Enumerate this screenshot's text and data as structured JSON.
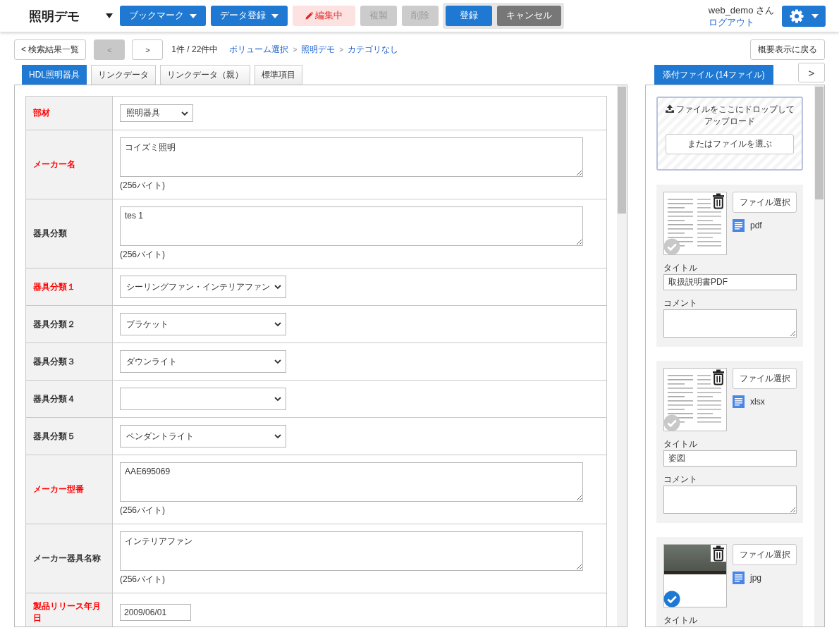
{
  "header": {
    "app_title": "照明デモ",
    "toolbar": [
      {
        "label": "ブックマーク",
        "kind": "menu",
        "disabled": false
      },
      {
        "label": "データ登録",
        "kind": "menu",
        "disabled": false
      },
      {
        "label": "編集中",
        "kind": "status",
        "disabled": false
      },
      {
        "label": "複製",
        "kind": "action",
        "disabled": true
      },
      {
        "label": "削除",
        "kind": "action",
        "disabled": true
      }
    ],
    "save_group": [
      {
        "label": "登録",
        "kind": "primary"
      },
      {
        "label": "キャンセル",
        "kind": "secondary"
      }
    ],
    "user": {
      "name": "web_demo さん",
      "logout_link": "ログアウト"
    }
  },
  "nav": {
    "back_button": "< 検索結果一覧",
    "prev_button": {
      "label": "<",
      "disabled": true
    },
    "next_button": {
      "label": ">",
      "disabled": false
    },
    "record_count": "1件 / 22件中",
    "breadcrumb": [
      {
        "kind": "link",
        "text": "ボリューム選択"
      },
      {
        "kind": "separator",
        "text": ">"
      },
      {
        "kind": "link",
        "text": "照明デモ"
      },
      {
        "kind": "separator",
        "text": ">"
      },
      {
        "kind": "link",
        "text": "カテゴリなし"
      }
    ],
    "overview_button": "概要表示に戻る"
  },
  "tabs": [
    {
      "label": "HDL照明器具",
      "selected": true
    },
    {
      "label": "リンクデータ",
      "selected": false
    },
    {
      "label": "リンクデータ（親）",
      "selected": false
    },
    {
      "label": "標準項目",
      "selected": false
    }
  ],
  "form": [
    {
      "label": "部材",
      "required": true,
      "kind": "select",
      "value": "照明器具"
    },
    {
      "label": "メーカー名",
      "required": true,
      "kind": "textarea",
      "value": "コイズミ照明",
      "note": "(256バイト)"
    },
    {
      "label": "器具分類",
      "required": false,
      "kind": "textarea",
      "value": "tes 1",
      "note": "(256バイト)"
    },
    {
      "label": "器具分類１",
      "required": true,
      "kind": "select",
      "value": "シーリングファン・インテリアファン"
    },
    {
      "label": "器具分類２",
      "required": false,
      "kind": "select",
      "value": "ブラケット"
    },
    {
      "label": "器具分類３",
      "required": false,
      "kind": "select",
      "value": "ダウンライト"
    },
    {
      "label": "器具分類４",
      "required": false,
      "kind": "select"
    },
    {
      "label": "器具分類５",
      "required": false,
      "kind": "select",
      "value": "ペンダントライト"
    },
    {
      "label": "メーカー型番",
      "required": true,
      "kind": "textarea",
      "value": "AAE695069",
      "note": "(256バイト)"
    },
    {
      "label": "メーカー器具名称",
      "required": false,
      "kind": "textarea",
      "value": "インテリアファン",
      "note": "(256バイト)"
    },
    {
      "label": "製品リリース年月日",
      "required": true,
      "kind": "date",
      "value": "2009/06/01"
    }
  ],
  "attachments": {
    "tab": {
      "label": "添付ファイル (14ファイル)",
      "selected": true
    },
    "next_button": ">",
    "dropzone": {
      "text": "ファイルをここにドロップしてアップロード",
      "button": "またはファイルを選ぶ"
    },
    "files": [
      {
        "kind": "document",
        "selected": false,
        "file_button": "ファイル選択",
        "type": "pdf",
        "title_label": "タイトル",
        "title": "取扱説明書PDF",
        "comment_label": "コメント"
      },
      {
        "kind": "document",
        "selected": false,
        "file_button": "ファイル選択",
        "type": "xlsx",
        "title_label": "タイトル",
        "title": "姿図",
        "comment_label": "コメント"
      },
      {
        "kind": "photo",
        "selected": true,
        "file_button": "ファイル選択",
        "type": "jpg",
        "title_label": "タイトル"
      }
    ]
  }
}
